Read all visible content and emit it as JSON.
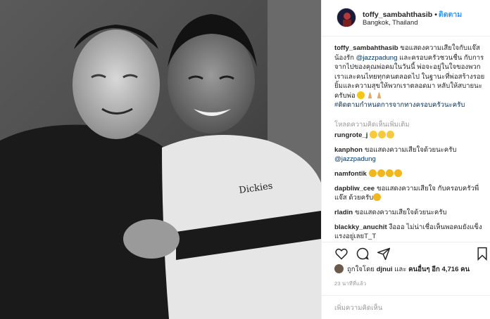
{
  "header": {
    "username": "toffy_sambahthasib",
    "separator": "•",
    "follow_label": "ติดตาม",
    "location": "Bangkok, Thailand"
  },
  "caption": {
    "username": "toffy_sambahthasib",
    "text1": "ขอแสดงความเสียใจกับแจ๊ส น้องรัก",
    "mention": "@jazzpadung",
    "text2": "และครอบครัวชวนชื่น กับการจากไปของคุณพ่อคมในวันนี้ พ่อจะอยู่ในใจของพวกเราและคนไทยทุกคนตลอดไป ในฐานะที่พ่อสร้างรอยยิ้มและความสุขให้พวกเราตลอดมา หลับให้สบายนะครับพ่อ",
    "hashtag": "#ติดตามกำหนดการจากทางครอบครัวนะครับ"
  },
  "load_more_label": "โหลดความคิดเห็นเพิ่มเติม",
  "comments": [
    {
      "user": "rungrote_j",
      "text": ""
    },
    {
      "user": "kanphon",
      "text": "ขอแสดงความเสียใจด้วยนะครับ",
      "mention": "@jazzpadung"
    },
    {
      "user": "namfontik",
      "text": ""
    },
    {
      "user": "dapbliw_cee",
      "text": "ขอแสดงความเสียใจ กับครอบครัวพี่แจ๊ส ด้วยครับ"
    },
    {
      "user": "rladin",
      "text": "ขอแสดงความเสียใจด้วยนะครับ"
    },
    {
      "user": "blackky_anuchit",
      "text": "งือออ ไม่น่าเชื่อเห็นพอคมยังแข็งแรงอยู่เลยT_T"
    }
  ],
  "likes": {
    "prefix": "ถูกใจโดย",
    "first": "djnui",
    "middle": "และ",
    "others": "คนอื่นๆ อีก 4,716 คน"
  },
  "timestamp": "23 นาทีที่แล้ว",
  "add_comment_placeholder": "เพิ่มความคิดเห็น",
  "icons": {
    "like": "heart-icon",
    "comment": "comment-icon",
    "share": "share-icon",
    "save": "bookmark-icon"
  },
  "colors": {
    "link": "#003569",
    "follow": "#3897f0",
    "muted": "#999999",
    "border": "#efefef"
  }
}
